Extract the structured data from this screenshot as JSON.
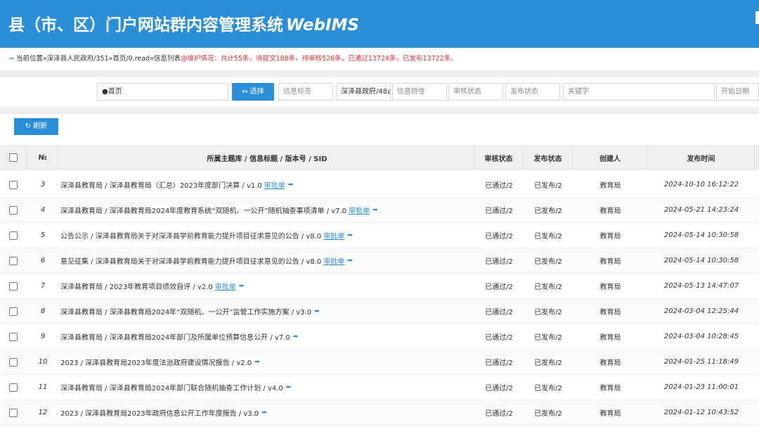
{
  "header": {
    "title": "县（市、区）门户网站群内容管理系统",
    "brand": "WebIMS"
  },
  "location": {
    "path": "当前位置»深泽县人民政府/351»首页/0.read»信息列表",
    "stats": "@维护情况：共计55条，待提交188条，待审核526条，已通过13724条，已发布13722条。"
  },
  "toolbar": {
    "home_field": "●首页",
    "select_button": "↔ 选择",
    "tag_placeholder": "信息标签",
    "dept_field": "深泽县政府/48a",
    "feature_placeholder": "信息特性",
    "audit_placeholder": "审核状态",
    "publish_placeholder": "发布状态",
    "keyword_placeholder": "关键字",
    "start_date_placeholder": "开始日期"
  },
  "refresh_button": "↻ 刷新",
  "table": {
    "headers": {
      "no": "№",
      "title": "所属主题库 / 信息标题 / 版本号 / SID",
      "audit": "审核状态",
      "publish": "发布状态",
      "creator": "创建人",
      "time": "发布时间"
    },
    "rows": [
      {
        "no": "3",
        "title": "深泽县教育局 / 深泽县教育局（汇总）2023年度部门决算 / v1.0",
        "link": "审批单",
        "go": "➡",
        "audit": "已通过/2",
        "publish": "已发布/2",
        "creator": "教育局",
        "time": "2024-10-10 16:12:22"
      },
      {
        "no": "4",
        "title": "深泽县教育局 / 深泽县教育局2024年度教育系统“双随机、一公开”随机抽查事项清单 / v7.0",
        "link": "审批单",
        "go": "➡",
        "audit": "已通过/2",
        "publish": "已发布/2",
        "creator": "教育局",
        "time": "2024-05-21 14:23:24"
      },
      {
        "no": "5",
        "title": "公告公示 / 深泽县教育局关于对深泽县学前教育能力提升项目征求意见的公告 / v8.0",
        "link": "审批单",
        "go": "➡",
        "audit": "已通过/2",
        "publish": "已发布/2",
        "creator": "教育局",
        "time": "2024-05-14 10:30:58"
      },
      {
        "no": "6",
        "title": "意见征集 / 深泽县教育局关于对深泽县学前教育能力提升项目征求意见的公告 / v8.0",
        "link": "审批单",
        "go": "➡",
        "audit": "已通过/2",
        "publish": "已发布/2",
        "creator": "教育局",
        "time": "2024-05-14 10:30:58"
      },
      {
        "no": "7",
        "title": "深泽县教育局 / 2023年教育项目绩效自评 / v2.0",
        "link": "审批单",
        "go": "➡",
        "audit": "已通过/2",
        "publish": "已发布/2",
        "creator": "教育局",
        "time": "2024-05-13 14:47:07"
      },
      {
        "no": "8",
        "title": "深泽县教育局 / 深泽县教育局2024年“双随机、一公开”监管工作实施方案 / v3.0",
        "link": "",
        "go": "➡",
        "audit": "已通过/2",
        "publish": "已发布/2",
        "creator": "教育局",
        "time": "2024-03-04 12:25:44"
      },
      {
        "no": "9",
        "title": "深泽县教育局 / 深泽县教育局2024年部门及所属单位预算信息公开 / v7.0",
        "link": "",
        "go": "➡",
        "audit": "已通过/2",
        "publish": "已发布/2",
        "creator": "教育局",
        "time": "2024-03-04 10:28:45"
      },
      {
        "no": "10",
        "title": "2023 / 深泽县教育局2023年度法治政府建设情况报告 / v2.0",
        "link": "",
        "go": "➡",
        "audit": "已通过/2",
        "publish": "已发布/2",
        "creator": "教育局",
        "time": "2024-01-25 11:18:49"
      },
      {
        "no": "11",
        "title": "深泽县教育局 / 深泽县教育局2024年部门联合随机抽查工作计划 / v4.0",
        "link": "",
        "go": "➡",
        "audit": "已通过/2",
        "publish": "已发布/2",
        "creator": "教育局",
        "time": "2024-01-23 11:00:01"
      },
      {
        "no": "12",
        "title": "2023 / 深泽县教育局2023年政府信息公开工作年度报告 / v3.0",
        "link": "",
        "go": "➡",
        "audit": "已通过/2",
        "publish": "已发布/2",
        "creator": "教育局",
        "time": "2024-01-12 10:43:52"
      }
    ]
  }
}
